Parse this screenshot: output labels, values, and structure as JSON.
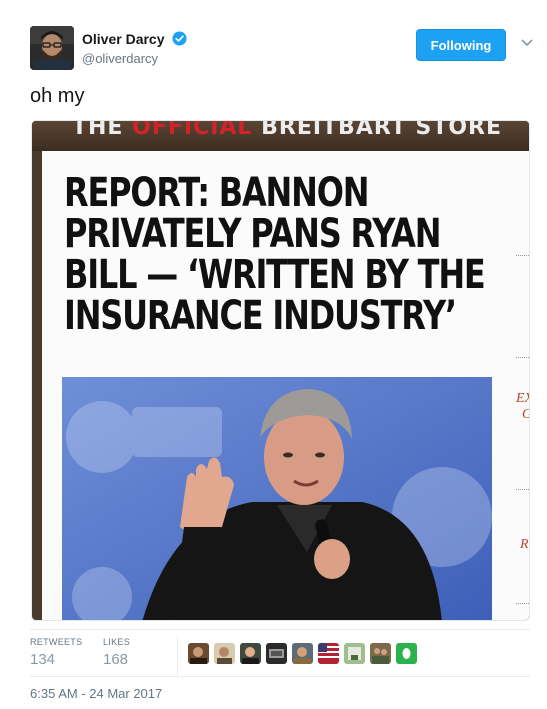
{
  "tweet": {
    "author": {
      "display_name": "Oliver Darcy",
      "handle": "@oliverdarcy",
      "verified_icon": "verified-badge-icon"
    },
    "follow_button_label": "Following",
    "text": "oh my",
    "media": {
      "store_banner": {
        "word_the": "THE",
        "word_official": "OFFICIAL",
        "word_rest": "BREITBART STORE"
      },
      "headline_lines": [
        "REPORT: BANNON",
        "PRIVATELY PANS RYAN",
        "BILL — ‘WRITTEN BY THE",
        "INSURANCE INDUSTRY’"
      ],
      "side_fragments": [
        "EX",
        "G",
        "R"
      ]
    },
    "stats": {
      "retweets_label": "RETWEETS",
      "retweets_value": "134",
      "likes_label": "LIKES",
      "likes_value": "168"
    },
    "timestamp": "6:35 AM - 24 Mar 2017"
  },
  "colors": {
    "follow_blue": "#1da1f2",
    "muted_text": "#657786"
  }
}
